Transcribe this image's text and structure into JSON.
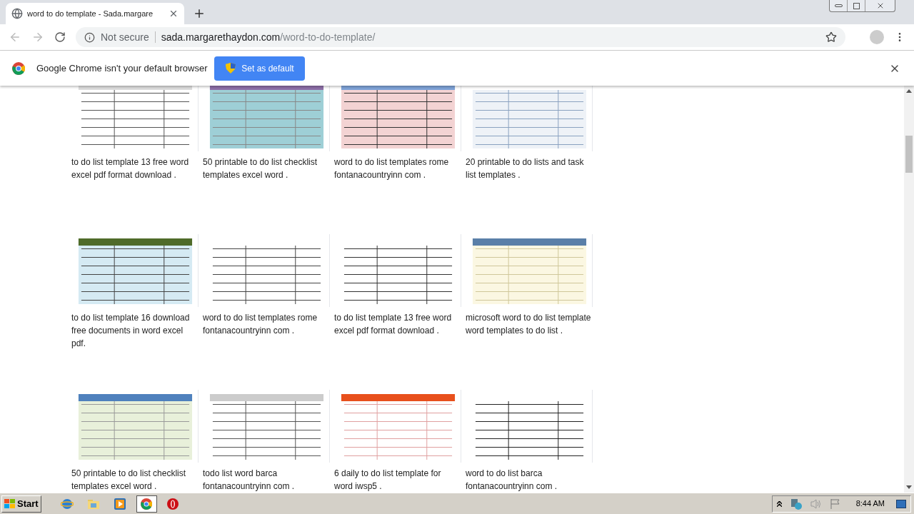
{
  "tab": {
    "title": "word to do template - Sada.margare",
    "selected": true
  },
  "address": {
    "security": "Not secure",
    "host": "sada.margarethaydon.com",
    "path": "/word-to-do-template/"
  },
  "infobar": {
    "message": "Google Chrome isn't your default browser",
    "button": "Set as default"
  },
  "results": [
    {
      "kind": "picture",
      "caption": "to do list template 13 free word excel pdf format download ."
    },
    {
      "kind": "picture",
      "caption": "50 printable to do list checklist templates excel word ."
    },
    {
      "kind": "picture",
      "caption": "word to do list templates rome fontanacountryinn com ."
    },
    {
      "kind": "picture",
      "caption": "20 printable to do lists and task list templates ."
    },
    {
      "kind": "picture",
      "caption": "to do list template 16 download free documents in word excel pdf."
    },
    {
      "kind": "picture",
      "caption": "word to do list templates rome fontanacountryinn com ."
    },
    {
      "kind": "picture",
      "caption": "to do list template 13 free word excel pdf format download ."
    },
    {
      "kind": "picture",
      "caption": "microsoft word to do list template word templates to do list ."
    },
    {
      "kind": "picture",
      "caption": "50 printable to do list checklist templates excel word ."
    },
    {
      "kind": "picture",
      "caption": "todo list word barca fontanacountryinn com ."
    },
    {
      "kind": "picture",
      "caption": "6 daily to do list template for word iwsp5 ."
    },
    {
      "kind": "picture",
      "caption": "word to do list barca fontanacountryinn com ."
    }
  ],
  "taskbar": {
    "start": "Start",
    "clock": "8:44 AM",
    "apps": [
      {
        "selected": false
      },
      {
        "selected": false
      },
      {
        "selected": false
      },
      {
        "selected": true
      },
      {
        "selected": false
      }
    ]
  }
}
